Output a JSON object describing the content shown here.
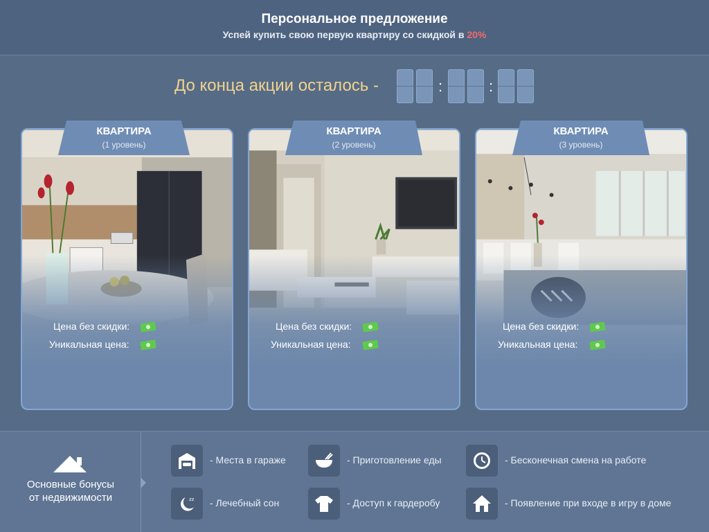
{
  "header": {
    "title": "Персональное предложение",
    "subtitle_prefix": "Успей купить свою первую квартиру со скидкой в",
    "subtitle_discount": "20%"
  },
  "timer": {
    "label": "До конца акции осталось -",
    "separator": ":"
  },
  "cards": [
    {
      "title": "КВАРТИРА",
      "level": "(1 уровень)",
      "price_label": "Цена без скидки:",
      "unique_label": "Уникальная цена:"
    },
    {
      "title": "КВАРТИРА",
      "level": "(2 уровень)",
      "price_label": "Цена без скидки:",
      "unique_label": "Уникальная цена:"
    },
    {
      "title": "КВАРТИРА",
      "level": "(3 уровень)",
      "price_label": "Цена без скидки:",
      "unique_label": "Уникальная цена:"
    }
  ],
  "bonuses": {
    "title_line1": "Основные бонусы",
    "title_line2": "от недвижимости",
    "items": [
      {
        "icon": "garage-icon",
        "label": "- Места в гараже"
      },
      {
        "icon": "food-bowl-icon",
        "label": "- Приготовление еды"
      },
      {
        "icon": "clock-icon",
        "label": "- Бесконечная смена на работе"
      },
      {
        "icon": "sleep-moon-icon",
        "label": "- Лечебный сон"
      },
      {
        "icon": "tshirt-icon",
        "label": "- Доступ к гардеробу"
      },
      {
        "icon": "home-icon",
        "label": "- Появление при входе в игру в доме"
      }
    ]
  },
  "colors": {
    "background": "#566b86",
    "accent_discount": "#f36a6a",
    "timer_label": "#f3d38d",
    "card_border": "#84a6d6",
    "tab": "#6f8cb4"
  }
}
